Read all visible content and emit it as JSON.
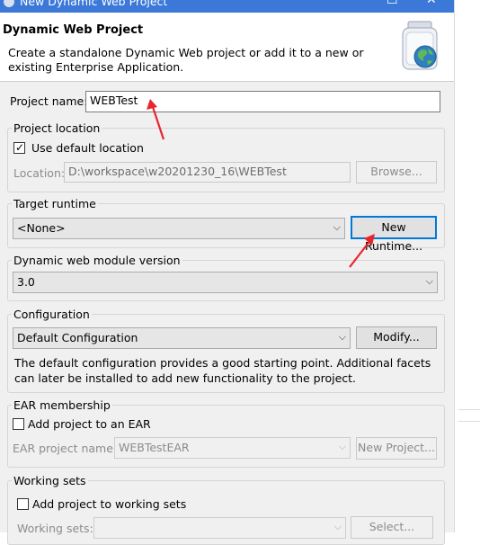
{
  "window": {
    "title": "New Dynamic Web Project",
    "minimize_glyph": "─",
    "maximize_glyph": "☐",
    "close_glyph": "✕"
  },
  "banner": {
    "title": "Dynamic Web Project",
    "description": "Create a standalone Dynamic Web project or add it to a new or existing Enterprise Application.",
    "icon": "web-project-jar-icon"
  },
  "project": {
    "name_label": "Project name:",
    "name_value": "WEBTest"
  },
  "location": {
    "group_label": "Project location",
    "use_default_label": "Use default location",
    "use_default_checked": true,
    "location_label": "Location:",
    "location_value": "D:\\workspace\\w20201230_16\\WEBTest",
    "browse_label": "Browse..."
  },
  "runtime": {
    "group_label": "Target runtime",
    "selected": "<None>",
    "new_runtime_label": "New Runtime..."
  },
  "module_version": {
    "group_label": "Dynamic web module version",
    "selected": "3.0"
  },
  "configuration": {
    "group_label": "Configuration",
    "selected": "Default Configuration",
    "modify_label": "Modify...",
    "description": "The default configuration provides a good starting point. Additional facets can later be installed to add new functionality to the project."
  },
  "ear": {
    "group_label": "EAR membership",
    "add_label": "Add project to an EAR",
    "add_checked": false,
    "project_name_label": "EAR project name:",
    "project_name_value": "WEBTestEAR",
    "new_project_label": "New Project..."
  },
  "working_sets": {
    "group_label": "Working sets",
    "add_label": "Add project to working sets",
    "add_checked": false,
    "sets_label": "Working sets:",
    "select_label": "Select..."
  },
  "colors": {
    "title_bar": "#3b78d8",
    "annotation_arrow": "#e8252a",
    "dialog_background": "#f0f0f0"
  },
  "checkmark_glyph": "✓",
  "chevron_glyph": "⌵"
}
